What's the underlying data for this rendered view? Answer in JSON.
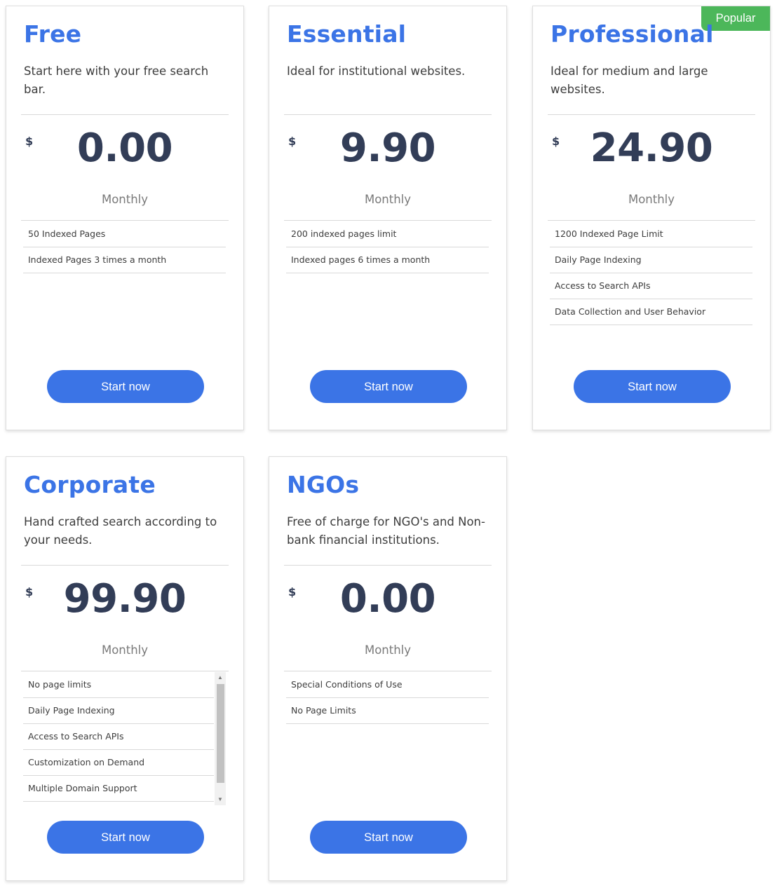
{
  "colors": {
    "accent": "#3b74e6",
    "price": "#323d57",
    "badge": "#4cb75a"
  },
  "plans": [
    {
      "name": "Free",
      "description": "Start here with your free search bar.",
      "currency": "$",
      "price": "0.00",
      "period": "Monthly",
      "features": [
        "50 Indexed Pages",
        "Indexed Pages 3 times a month"
      ],
      "cta": "Start now"
    },
    {
      "name": "Essential",
      "description": "Ideal for institutional websites.",
      "currency": "$",
      "price": "9.90",
      "period": "Monthly",
      "features": [
        "200 indexed pages limit",
        "Indexed pages 6 times a month"
      ],
      "cta": "Start now"
    },
    {
      "name": "Professional",
      "badge": "Popular",
      "description": "Ideal for medium and large websites.",
      "currency": "$",
      "price": "24.90",
      "period": "Monthly",
      "features": [
        "1200 Indexed Page Limit",
        "Daily Page Indexing",
        "Access to Search APIs",
        "Data Collection and User Behavior"
      ],
      "cta": "Start now"
    },
    {
      "name": "Corporate",
      "description": "Hand crafted search according to your needs.",
      "currency": "$",
      "price": "99.90",
      "period": "Monthly",
      "features": [
        "No page limits",
        "Daily Page Indexing",
        "Access to Search APIs",
        "Customization on Demand",
        "Multiple Domain Support"
      ],
      "cta": "Start now"
    },
    {
      "name": "NGOs",
      "description": "Free of charge for NGO's and Non-bank financial institutions.",
      "currency": "$",
      "price": "0.00",
      "period": "Monthly",
      "features": [
        "Special Conditions of Use",
        "No Page Limits"
      ],
      "cta": "Start now"
    }
  ]
}
